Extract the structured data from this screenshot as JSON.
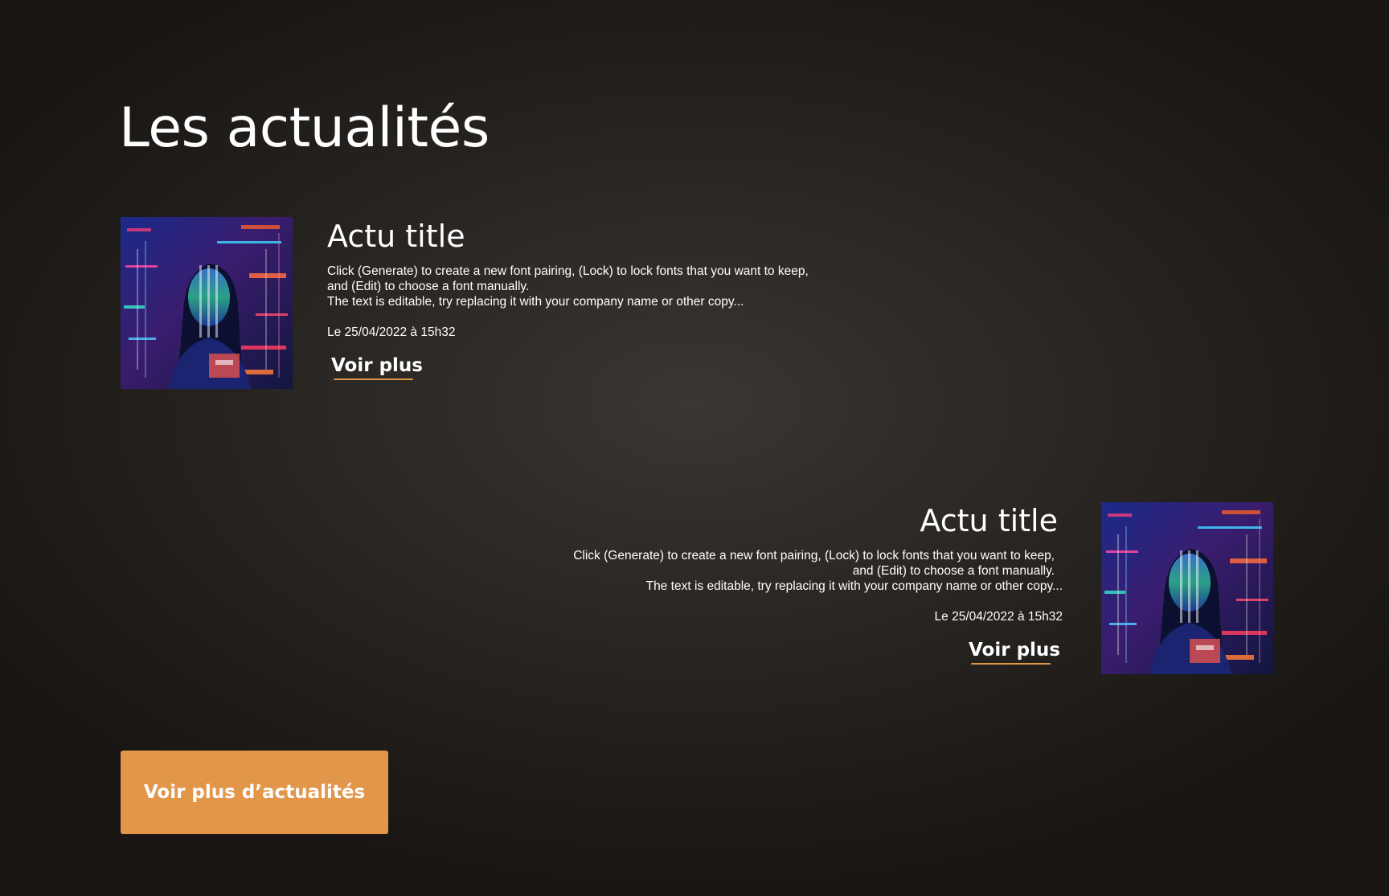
{
  "page": {
    "title": "Les actualités"
  },
  "articles": [
    {
      "title": "Actu title",
      "excerpt_lines": [
        "Click (Generate) to create a new font pairing, (Lock) to lock fonts that you want to keep,",
        "and (Edit) to choose a font manually.",
        "The text is editable, try replacing it with your company name or other copy..."
      ],
      "date": "Le 25/04/2022 à 15h32",
      "link_label": "Voir plus",
      "image_alignment": "left"
    },
    {
      "title": "Actu title",
      "excerpt_lines": [
        "Click (Generate) to create a new font pairing, (Lock) to lock fonts that you want to keep,",
        "and (Edit) to choose a font manually.",
        "The text is editable, try replacing it with your company name or other copy..."
      ],
      "date": "Le 25/04/2022 à 15h32",
      "link_label": "Voir plus",
      "image_alignment": "right"
    }
  ],
  "cta": {
    "label": "Voir plus d’actualités"
  },
  "colors": {
    "accent": "#e2964a",
    "background": "#262320",
    "text": "#ffffff"
  },
  "icons": {
    "article_image": "portrait-with-code-projection-image"
  }
}
